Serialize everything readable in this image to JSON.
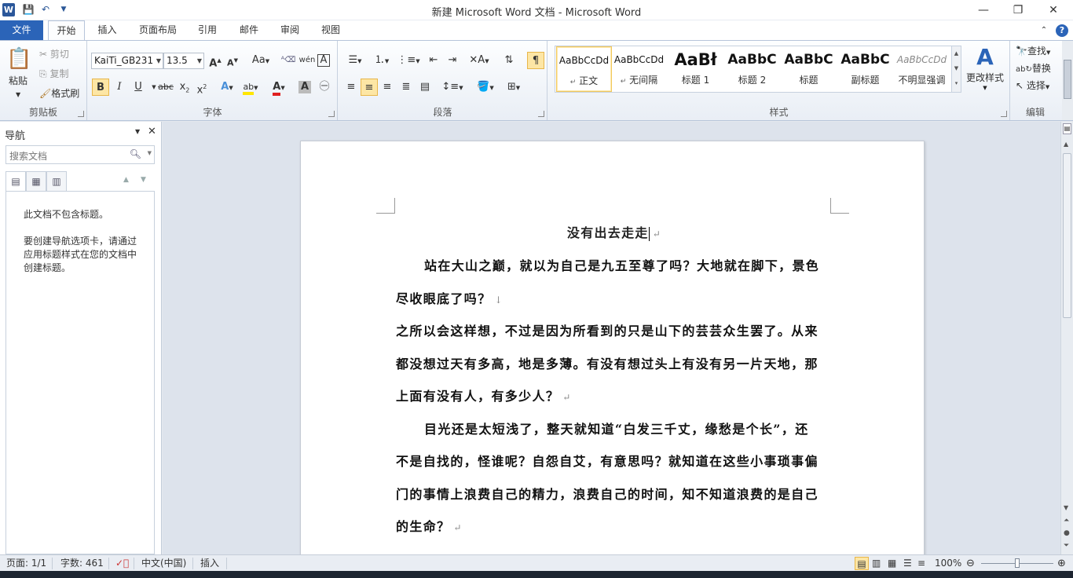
{
  "window": {
    "title": "新建 Microsoft Word 文档  -  Microsoft Word",
    "app_icon": "W"
  },
  "tabs": [
    {
      "label": "文件"
    },
    {
      "label": "开始"
    },
    {
      "label": "插入"
    },
    {
      "label": "页面布局"
    },
    {
      "label": "引用"
    },
    {
      "label": "邮件"
    },
    {
      "label": "审阅"
    },
    {
      "label": "视图"
    }
  ],
  "clipboard": {
    "paste": "粘贴",
    "cut": "剪切",
    "copy": "复制",
    "format_painter": "格式刷",
    "label": "剪贴板"
  },
  "font": {
    "name": "KaiTi_GB2312",
    "size": "13.5",
    "label": "字体",
    "case_btn": "Aa"
  },
  "paragraph": {
    "label": "段落"
  },
  "styles": {
    "label": "样式",
    "change": "更改样式",
    "items": [
      {
        "preview": "AaBbCcDd",
        "name": "正文",
        "marker": "↵"
      },
      {
        "preview": "AaBbCcDd",
        "name": "无间隔",
        "marker": "↵"
      },
      {
        "preview": "AaBł",
        "name": "标题 1"
      },
      {
        "preview": "AaBbC",
        "name": "标题 2"
      },
      {
        "preview": "AaBbC",
        "name": "标题"
      },
      {
        "preview": "AaBbC",
        "name": "副标题"
      },
      {
        "preview": "AaBbCcDd",
        "name": "不明显强调"
      }
    ]
  },
  "editing": {
    "find": "查找",
    "replace": "替换",
    "select": "选择",
    "label": "编辑"
  },
  "nav": {
    "title": "导航",
    "search_placeholder": "搜索文档",
    "msg1": "此文档不包含标题。",
    "msg2": "要创建导航选项卡，请通过应用标题样式在您的文档中创建标题。"
  },
  "document": {
    "title": "没有出去走走",
    "lines": [
      {
        "text": "站在大山之巅，就以为自己是九五至尊了吗？大地就在脚下，景色",
        "indent": true
      },
      {
        "text": "尽收眼底了吗？",
        "mark": "↓"
      },
      {
        "text": "之所以会这样想，不过是因为所看到的只是山下的芸芸众生罢了。从来"
      },
      {
        "text": "都没想过天有多高，地是多薄。有没有想过头上有没有另一片天地，那"
      },
      {
        "text": "上面有没有人，有多少人？",
        "mark": "↵"
      },
      {
        "text": "目光还是太短浅了，整天就知道“白发三千丈，缘愁是个长”，还",
        "indent": true
      },
      {
        "text": "不是自找的，怪谁呢？自怨自艾，有意思吗？就知道在这些小事琐事偏"
      },
      {
        "text": "门的事情上浪费自己的精力，浪费自己的时间，知不知道浪费的是自己"
      },
      {
        "text": "的生命？",
        "mark": "↵"
      }
    ]
  },
  "status": {
    "page": "页面: 1/1",
    "words": "字数: 461",
    "lang": "中文(中国)",
    "mode": "插入",
    "zoom": "100%"
  },
  "colors": {
    "file_tab": "#2b64b8",
    "accent": "#2b579a",
    "highlight": "#fde6a5"
  }
}
